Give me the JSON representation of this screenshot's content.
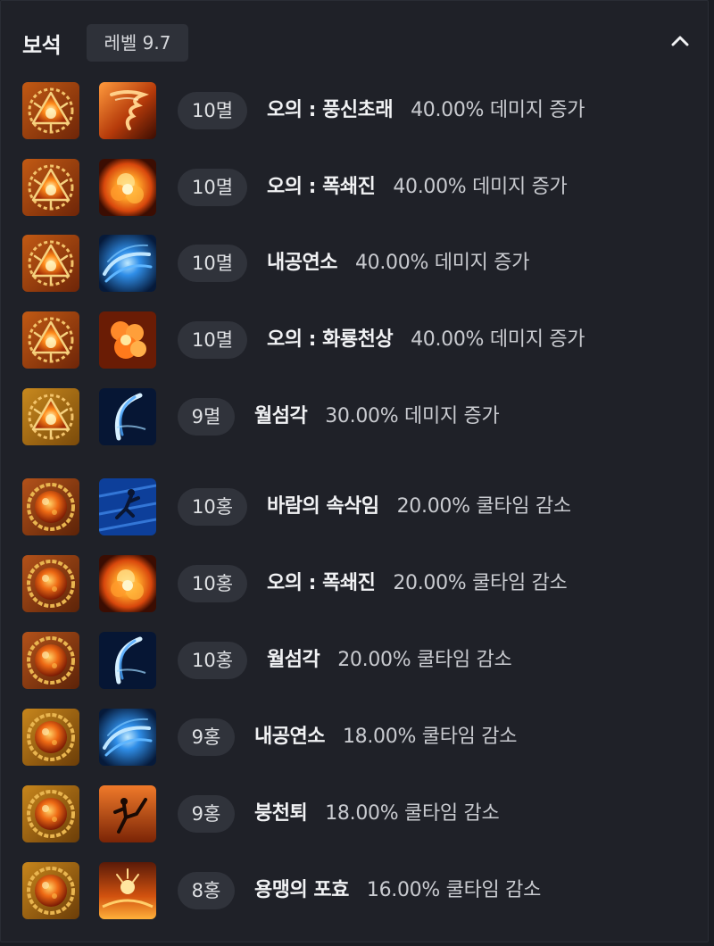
{
  "header": {
    "title": "보석",
    "level": "레벨 9.7"
  },
  "gems": [
    {
      "grade": "10멸",
      "skill": "오의 : 풍신초래",
      "effect": "40.00% 데미지 증가",
      "gem_icon": "annihilation-gem-icon",
      "skill_icon": "tornado-skill-icon"
    },
    {
      "grade": "10멸",
      "skill": "오의 : 폭쇄진",
      "effect": "40.00% 데미지 증가",
      "gem_icon": "annihilation-gem-icon",
      "skill_icon": "explosion-skill-icon"
    },
    {
      "grade": "10멸",
      "skill": "내공연소",
      "effect": "40.00% 데미지 증가",
      "gem_icon": "annihilation-gem-icon",
      "skill_icon": "blue-swirl-skill-icon"
    },
    {
      "grade": "10멸",
      "skill": "오의 : 화룡천상",
      "effect": "40.00% 데미지 증가",
      "gem_icon": "annihilation-gem-icon",
      "skill_icon": "fire-dragon-skill-icon"
    },
    {
      "grade": "9멸",
      "skill": "월섬각",
      "effect": "30.00% 데미지 증가",
      "gem_icon": "annihilation-gem-icon",
      "skill_icon": "crescent-kick-skill-icon"
    },
    {
      "grade": "10홍",
      "skill": "바람의 속삭임",
      "effect": "20.00% 쿨타임 감소",
      "gem_icon": "crimson-flame-gem-icon",
      "skill_icon": "wind-dash-skill-icon"
    },
    {
      "grade": "10홍",
      "skill": "오의 : 폭쇄진",
      "effect": "20.00% 쿨타임 감소",
      "gem_icon": "crimson-flame-gem-icon",
      "skill_icon": "explosion-skill-icon"
    },
    {
      "grade": "10홍",
      "skill": "월섬각",
      "effect": "20.00% 쿨타임 감소",
      "gem_icon": "crimson-flame-gem-icon",
      "skill_icon": "crescent-kick-skill-icon"
    },
    {
      "grade": "9홍",
      "skill": "내공연소",
      "effect": "18.00% 쿨타임 감소",
      "gem_icon": "crimson-flame-gem-icon",
      "skill_icon": "blue-swirl-skill-icon"
    },
    {
      "grade": "9홍",
      "skill": "붕천퇴",
      "effect": "18.00% 쿨타임 감소",
      "gem_icon": "crimson-flame-gem-icon",
      "skill_icon": "sky-kick-skill-icon"
    },
    {
      "grade": "8홍",
      "skill": "용맹의 포효",
      "effect": "16.00% 쿨타임 감소",
      "gem_icon": "crimson-flame-gem-icon",
      "skill_icon": "roar-skill-icon"
    }
  ]
}
